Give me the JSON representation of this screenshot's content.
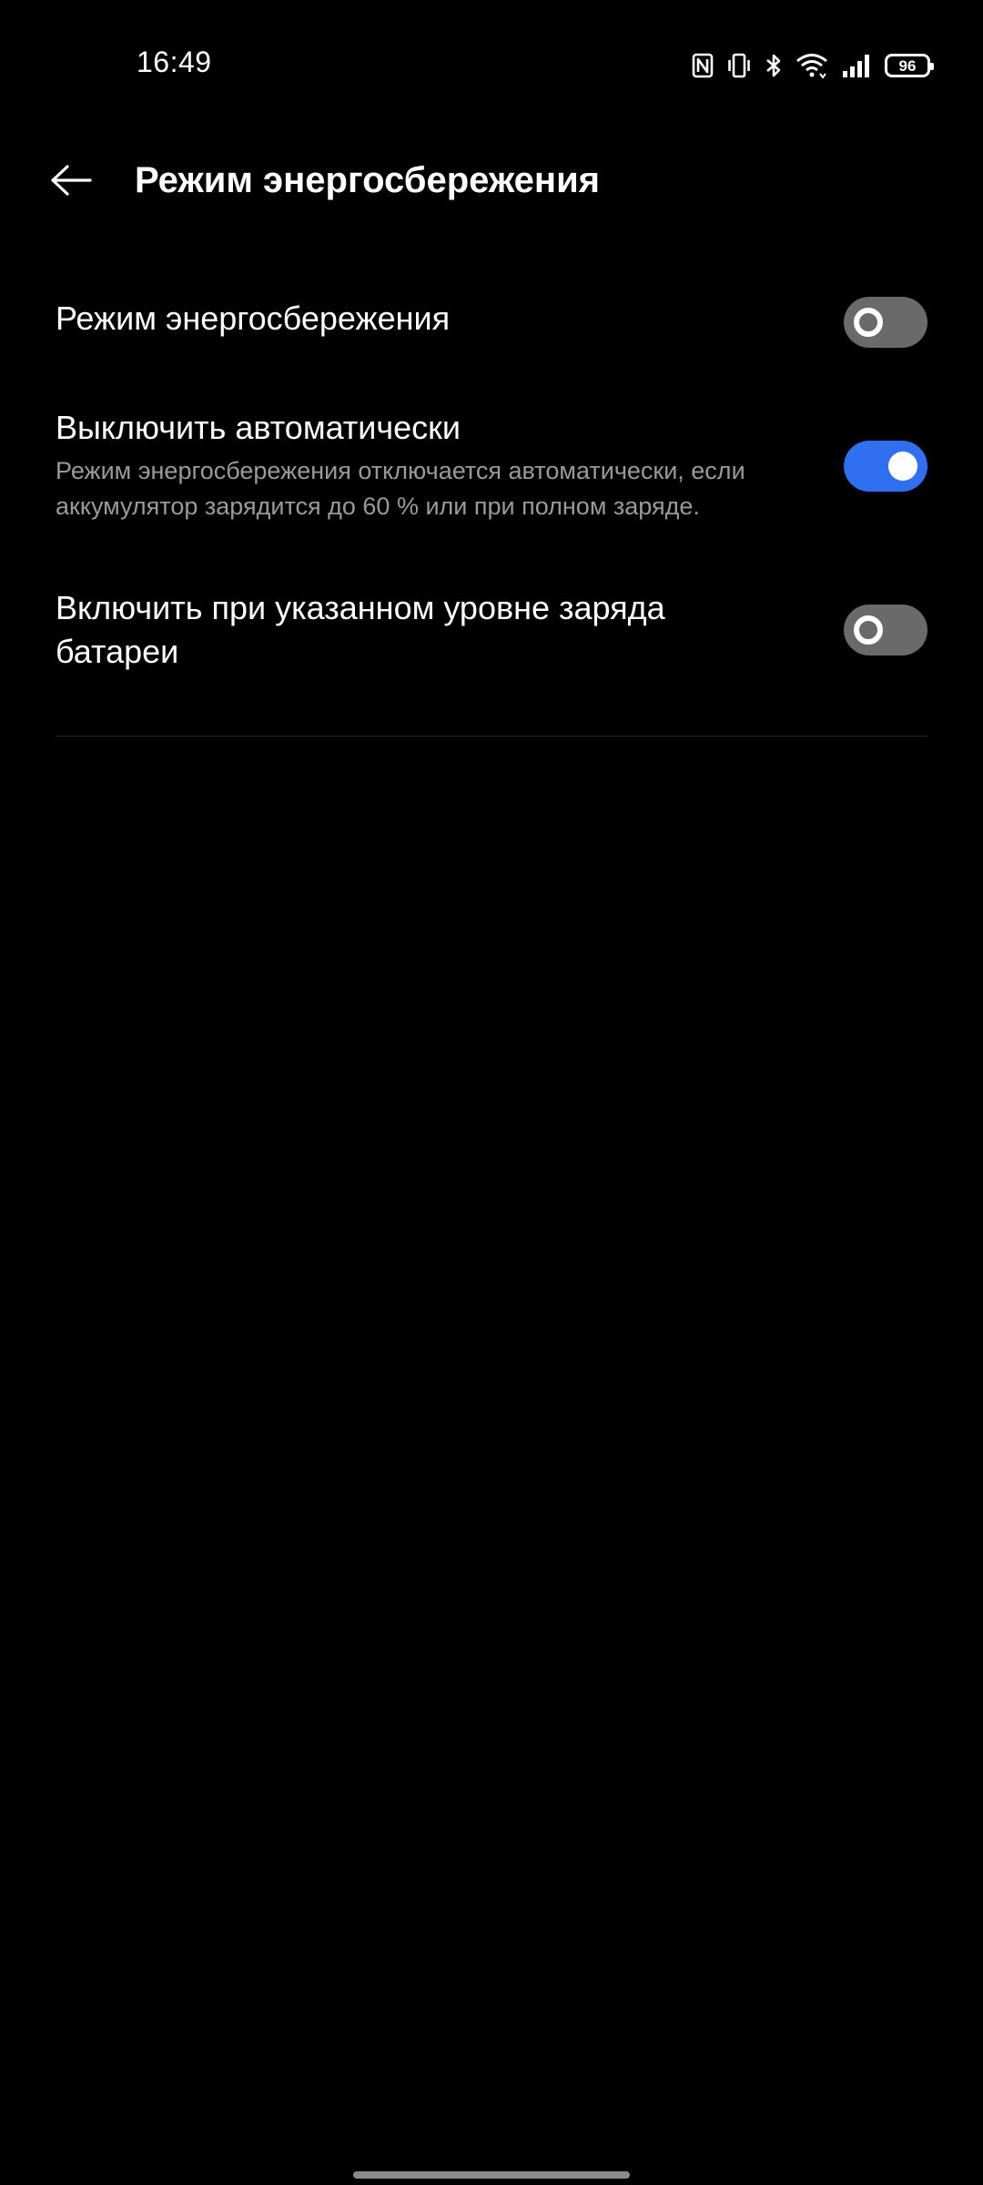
{
  "status_bar": {
    "time": "16:49",
    "battery_level": "96",
    "icons": [
      "nfc-icon",
      "vibrate-icon",
      "bluetooth-icon",
      "wifi-icon",
      "cellular-signal-icon",
      "battery-icon"
    ]
  },
  "header": {
    "back_icon": "arrow-left-icon",
    "title": "Режим энергосбережения"
  },
  "settings": [
    {
      "title": "Режим энергосбережения",
      "description": "",
      "enabled": false
    },
    {
      "title": "Выключить автоматически",
      "description": "Режим энергосбережения отключается автоматически, если аккумулятор зарядится до 60 % или при полном заряде.",
      "enabled": true
    },
    {
      "title": "Включить при указанном уровне заряда батареи",
      "description": "",
      "enabled": false
    }
  ],
  "colors": {
    "background": "#000000",
    "accent": "#2f6ff0",
    "toggle_off": "#6a6a6a",
    "secondary_text": "#9a9a9a"
  }
}
